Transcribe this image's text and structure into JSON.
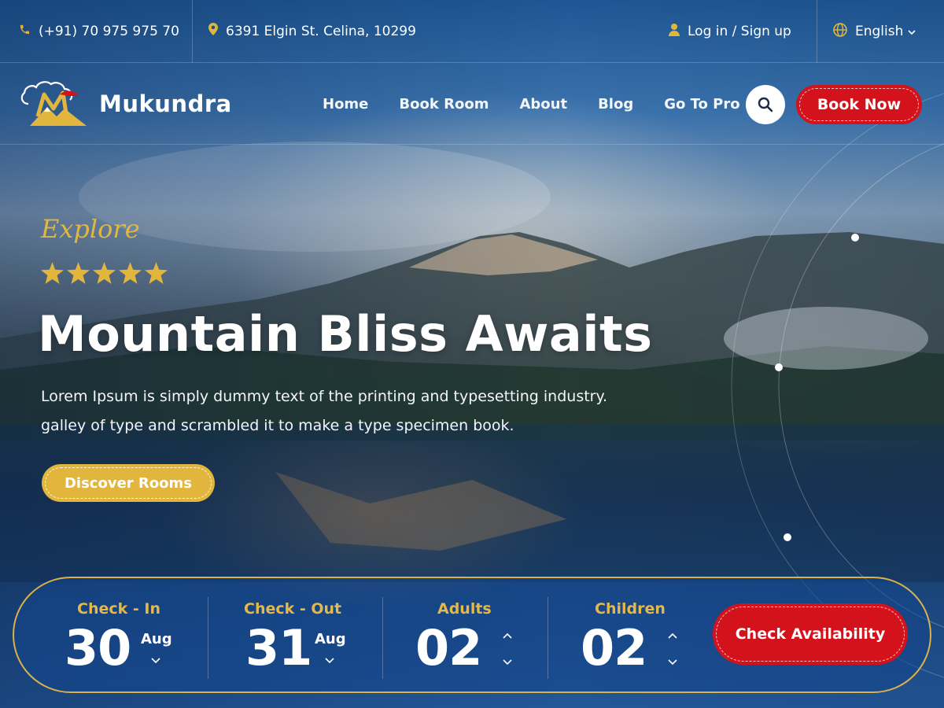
{
  "topbar": {
    "phone": "(+91) 70 975 975 70",
    "address": "6391 Elgin St. Celina, 10299",
    "login": "Log in / Sign up",
    "language": "English"
  },
  "nav": {
    "brand": "Mukundra",
    "items": [
      {
        "label": "Home"
      },
      {
        "label": "Book Room"
      },
      {
        "label": "About"
      },
      {
        "label": "Blog"
      },
      {
        "label": "Go To Pro"
      }
    ],
    "cta_label": "Book Now"
  },
  "hero": {
    "eyebrow": "Explore",
    "rating": 5,
    "title": "Mountain Bliss Awaits",
    "description_line1": "Lorem Ipsum is simply dummy text of the printing and typesetting industry.",
    "description_line2": "galley of type and scrambled it to make a type specimen book.",
    "button_label": "Discover Rooms"
  },
  "booking": {
    "checkin": {
      "label": "Check - In",
      "day": "30",
      "month": "Aug"
    },
    "checkout": {
      "label": "Check - Out",
      "day": "31",
      "month": "Aug"
    },
    "adults": {
      "label": "Adults",
      "value": "02"
    },
    "children": {
      "label": "Children",
      "value": "02"
    },
    "button_label": "Check Availability"
  },
  "colors": {
    "accent_gold": "#e2b63c",
    "accent_red": "#d3121b",
    "brand_blue": "#1f5a98"
  }
}
